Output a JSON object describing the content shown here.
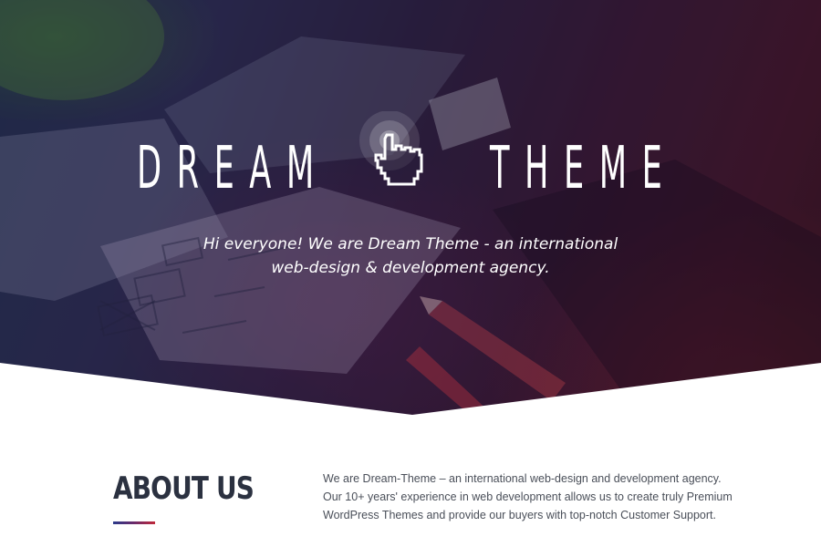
{
  "hero": {
    "brand_left": "DREAM",
    "brand_right": "THEME",
    "tagline_line1": "Hi everyone! We are Dream Theme - an international",
    "tagline_line2": "web-design & development agency.",
    "cursor_icon": "pointing-hand-click-icon"
  },
  "about": {
    "title": "ABOUT US",
    "text_line1": "We are Dream-Theme – an international web-design and development agency.",
    "text_line2": "Our 10+ years' experience in web development allows us to create truly Premium",
    "text_line3": "WordPress Themes and provide our buyers with top-notch Customer Support."
  },
  "colors": {
    "accent_blue": "#2a3a8a",
    "accent_red": "#c0283a",
    "heading": "#2b3140",
    "body_text": "#4a4f59"
  }
}
